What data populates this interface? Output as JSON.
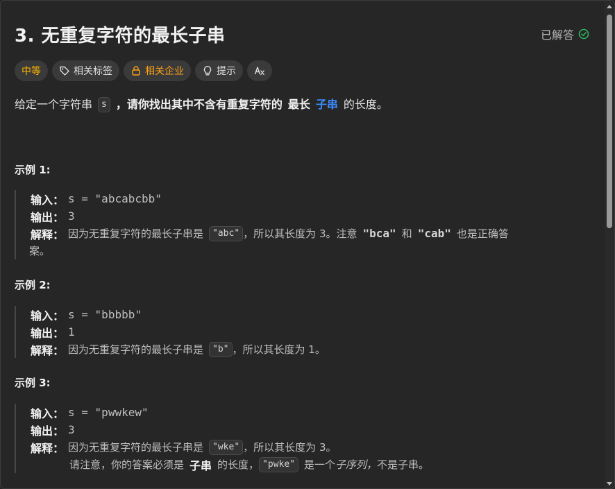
{
  "problem": {
    "title": "3. 无重复字符的最长子串",
    "status": "已解答"
  },
  "tags": [
    {
      "label": "中等",
      "icon": ""
    },
    {
      "label": "相关标签",
      "icon": "tag-icon"
    },
    {
      "label": "相关企业",
      "icon": "lock-icon"
    },
    {
      "label": "提示",
      "icon": "lightbulb-icon"
    },
    {
      "label": "",
      "icon": "translate-icon"
    }
  ],
  "description": {
    "part1": "给定一个字符串",
    "code": "s",
    "part2": "，请你找出其中不含有重复字符的",
    "bold": "最长",
    "link": "子串",
    "part3": "的长度。"
  },
  "labels": {
    "input": "输入：",
    "output": "输出：",
    "explain": "解释："
  },
  "examples": [
    {
      "title": "示例 1:",
      "input": "s = \"abcabcbb\"",
      "output": "3",
      "explain_pre": "因为无重复字符的最长子串是",
      "explain_code": "\"abc\"",
      "explain_mid": "，所以其长度为 3。注意",
      "explain_q1": "\"bca\"",
      "explain_and": "和",
      "explain_q2": "\"cab\"",
      "explain_post": "也是正确答",
      "explain_wrap": "案。"
    },
    {
      "title": "示例 2:",
      "input": "s = \"bbbbb\"",
      "output": "1",
      "explain_pre": "因为无重复字符的最长子串是",
      "explain_code": "\"b\"",
      "explain_post": "，所以其长度为 1。"
    },
    {
      "title": "示例 3:",
      "input": "s = \"pwwkew\"",
      "output": "3",
      "explain_pre": "因为无重复字符的最长子串是",
      "explain_code": "\"wke\"",
      "explain_post": "，所以其长度为 3。",
      "note_pre": "请注意，你的答案必须是",
      "note_bold": "子串",
      "note_mid": "的长度，",
      "note_code": "\"pwke\"",
      "note_post1": "是一个",
      "note_italic": "子序列，",
      "note_post2": "不是子串。"
    }
  ],
  "colors": {
    "background": "#262626",
    "accent_blue": "#3c8cff",
    "medium": "#ffb800",
    "solved_green": "#2db55d"
  }
}
